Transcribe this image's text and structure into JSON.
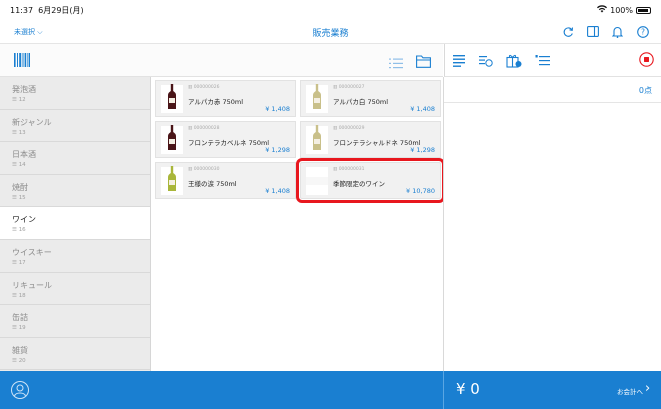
{
  "status_bar": {
    "time": "11:37",
    "date": "6月29日(月)",
    "battery": "100%"
  },
  "nav": {
    "store": "未選択",
    "title": "販売業務"
  },
  "categories": [
    {
      "name": "発泡酒",
      "count": "12",
      "active": false
    },
    {
      "name": "新ジャンル",
      "count": "13",
      "active": false
    },
    {
      "name": "日本酒",
      "count": "14",
      "active": false
    },
    {
      "name": "焼酎",
      "count": "15",
      "active": false
    },
    {
      "name": "ワイン",
      "count": "16",
      "active": true
    },
    {
      "name": "ウイスキー",
      "count": "17",
      "active": false
    },
    {
      "name": "リキュール",
      "count": "18",
      "active": false
    },
    {
      "name": "缶詰",
      "count": "19",
      "active": false
    },
    {
      "name": "雑貨",
      "count": "20",
      "active": false
    }
  ],
  "products": [
    {
      "code": "000000026",
      "name": "アルパカ赤 750ml",
      "price": "¥ 1,408",
      "bottle": "red"
    },
    {
      "code": "000000027",
      "name": "アルパカ白 750ml",
      "price": "¥ 1,408",
      "bottle": "white"
    },
    {
      "code": "000000028",
      "name": "フロンテラカベルネ 750ml",
      "price": "¥ 1,298",
      "bottle": "red"
    },
    {
      "code": "000000029",
      "name": "フロンテラシャルドネ 750ml",
      "price": "¥ 1,298",
      "bottle": "white"
    },
    {
      "code": "000000030",
      "name": "王様の涙 750ml",
      "price": "¥ 1,408",
      "bottle": "green"
    },
    {
      "code": "000000031",
      "name": "季節限定のワイン",
      "price": "¥ 10,780",
      "bottle": "none",
      "highlighted": true
    }
  ],
  "cart": {
    "count": "0点"
  },
  "footer": {
    "total": "¥ 0",
    "checkout": "お会計へ"
  },
  "colors": {
    "accent": "#1a7fd1",
    "highlight": "#e8171e",
    "stop": "#e8171e"
  },
  "icons": {
    "nav": [
      "refresh-icon",
      "panel-icon",
      "bell-icon",
      "help-icon"
    ],
    "cart_toolbar": [
      "receipt-icon",
      "discount-icon",
      "gift-icon",
      "list-settings-icon",
      "stop-icon"
    ]
  }
}
